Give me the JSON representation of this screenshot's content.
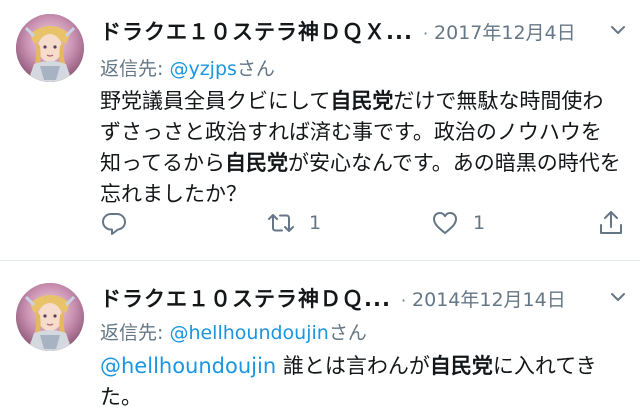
{
  "tweets": [
    {
      "display_name": "ドラクエ１０ステラ神ＤＱＸ...",
      "date": "2017年12月4日",
      "reply_prefix": "返信先: ",
      "reply_handle": "@yzjps",
      "reply_suffix": "さん",
      "body": {
        "p1": "野党議員全員クビにして",
        "b1": "自民党",
        "p2": "だけで無駄な時間使わずさっさと政治すれば済む事です。政治のノウハウを知ってるから",
        "b2": "自民党",
        "p3": "が安心なんです。あの暗黒の時代を忘れましたか？"
      },
      "retweet_count": "1",
      "like_count": "1"
    },
    {
      "display_name": "ドラクエ１０ステラ神ＤＱ...",
      "date": "2014年12月14日",
      "reply_prefix": "返信先: ",
      "reply_handle": "@hellhoundoujin",
      "reply_suffix": "さん",
      "body": {
        "mention": "@hellhoundoujin",
        "p1": " 誰とは言わんが",
        "b1": "自民党",
        "p2": "に入れてきた。"
      }
    }
  ],
  "dot_separator": "·",
  "colors": {
    "link": "#1b95e0",
    "secondary": "#657786",
    "text": "#14171a",
    "divider": "#e1e8ed"
  },
  "icons": {
    "reply": "reply-icon",
    "retweet": "retweet-icon",
    "like": "heart-icon",
    "share": "share-icon",
    "caret": "chevron-down-icon"
  }
}
